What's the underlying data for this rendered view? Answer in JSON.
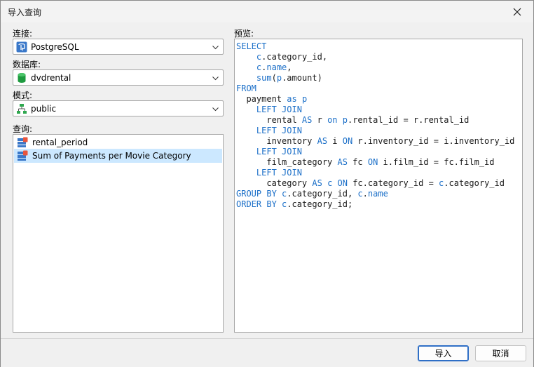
{
  "window": {
    "title": "导入查询"
  },
  "connection": {
    "label": "连接:",
    "value": "PostgreSQL",
    "icon": "postgresql-icon"
  },
  "database": {
    "label": "数据库:",
    "value": "dvdrental",
    "icon": "database-icon"
  },
  "schema": {
    "label": "模式:",
    "value": "public",
    "icon": "schema-icon"
  },
  "queries": {
    "label": "查询:",
    "items": [
      {
        "label": "rental_period",
        "selected": false
      },
      {
        "label": "Sum of Payments per Movie Category",
        "selected": true
      }
    ]
  },
  "preview": {
    "label": "预览:",
    "lines": [
      [
        [
          "kw",
          "SELECT"
        ]
      ],
      [
        [
          "t",
          "    "
        ],
        [
          "kw",
          "c"
        ],
        [
          "t",
          ".category_id,"
        ]
      ],
      [
        [
          "t",
          "    "
        ],
        [
          "kw",
          "c"
        ],
        [
          "t",
          "."
        ],
        [
          "kw",
          "name"
        ],
        [
          "t",
          ","
        ]
      ],
      [
        [
          "t",
          "    "
        ],
        [
          "kw",
          "sum"
        ],
        [
          "t",
          "("
        ],
        [
          "kw",
          "p"
        ],
        [
          "t",
          ".amount)"
        ]
      ],
      [
        [
          "kw",
          "FROM"
        ]
      ],
      [
        [
          "t",
          "  payment "
        ],
        [
          "kw",
          "as"
        ],
        [
          "t",
          " "
        ],
        [
          "kw",
          "p"
        ]
      ],
      [
        [
          "t",
          "    "
        ],
        [
          "kw",
          "LEFT JOIN"
        ]
      ],
      [
        [
          "t",
          "      rental "
        ],
        [
          "kw",
          "AS"
        ],
        [
          "t",
          " r "
        ],
        [
          "kw",
          "on"
        ],
        [
          "t",
          " "
        ],
        [
          "kw",
          "p"
        ],
        [
          "t",
          ".rental_id = r.rental_id"
        ]
      ],
      [
        [
          "t",
          "    "
        ],
        [
          "kw",
          "LEFT JOIN"
        ]
      ],
      [
        [
          "t",
          "      inventory "
        ],
        [
          "kw",
          "AS"
        ],
        [
          "t",
          " i "
        ],
        [
          "kw",
          "ON"
        ],
        [
          "t",
          " r.inventory_id = i.inventory_id"
        ]
      ],
      [
        [
          "t",
          "    "
        ],
        [
          "kw",
          "LEFT JOIN"
        ]
      ],
      [
        [
          "t",
          "      film_category "
        ],
        [
          "kw",
          "AS"
        ],
        [
          "t",
          " fc "
        ],
        [
          "kw",
          "ON"
        ],
        [
          "t",
          " i.film_id = fc.film_id"
        ]
      ],
      [
        [
          "t",
          "    "
        ],
        [
          "kw",
          "LEFT JOIN"
        ]
      ],
      [
        [
          "t",
          "      category "
        ],
        [
          "kw",
          "AS"
        ],
        [
          "t",
          " "
        ],
        [
          "kw",
          "c"
        ],
        [
          "t",
          " "
        ],
        [
          "kw",
          "ON"
        ],
        [
          "t",
          " fc.category_id = "
        ],
        [
          "kw",
          "c"
        ],
        [
          "t",
          ".category_id"
        ]
      ],
      [
        [
          "kw",
          "GROUP BY"
        ],
        [
          "t",
          " "
        ],
        [
          "kw",
          "c"
        ],
        [
          "t",
          ".category_id, "
        ],
        [
          "kw",
          "c"
        ],
        [
          "t",
          "."
        ],
        [
          "kw",
          "name"
        ]
      ],
      [
        [
          "kw",
          "ORDER BY"
        ],
        [
          "t",
          " "
        ],
        [
          "kw",
          "c"
        ],
        [
          "t",
          ".category_id;"
        ]
      ]
    ]
  },
  "buttons": {
    "import": "导入",
    "cancel": "取消"
  },
  "colors": {
    "keyword": "#1b6fc8",
    "selection": "#cce8ff",
    "primary_border": "#2f6fc6"
  }
}
